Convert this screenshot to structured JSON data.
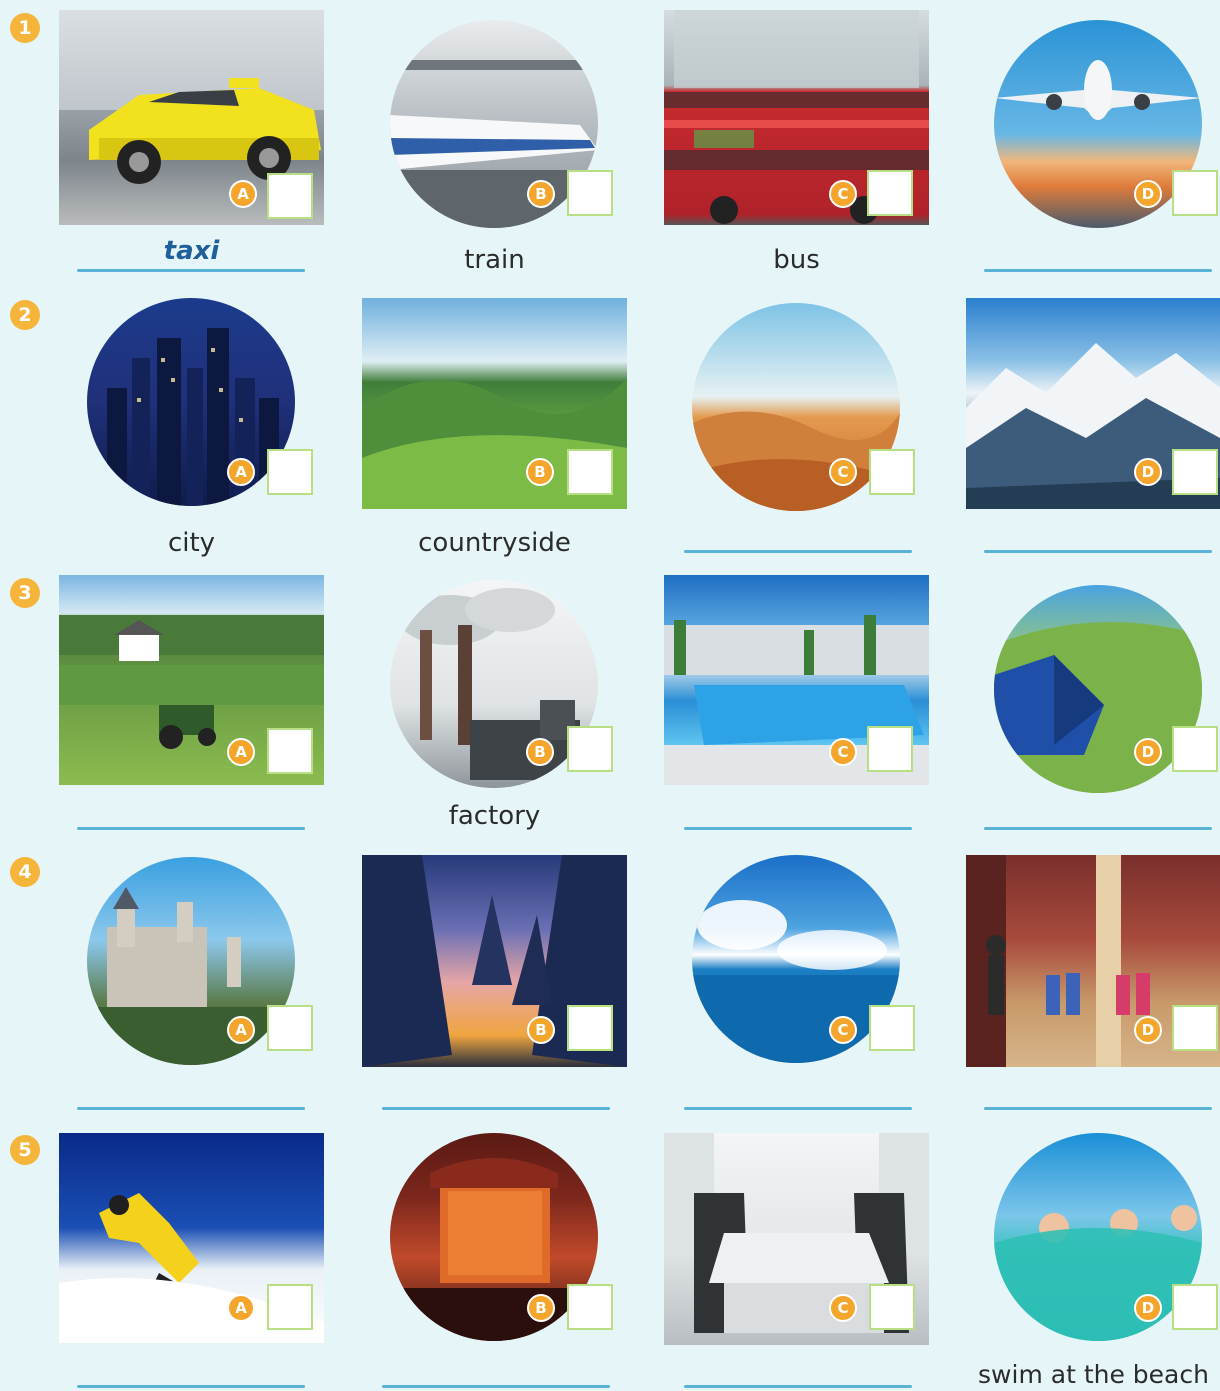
{
  "rows": [
    {
      "number": "1",
      "cells": [
        {
          "letter": "A",
          "caption": "taxi",
          "style": "written"
        },
        {
          "letter": "B",
          "caption": "train"
        },
        {
          "letter": "C",
          "caption": "bus"
        },
        {
          "letter": "D",
          "caption": ""
        }
      ]
    },
    {
      "number": "2",
      "cells": [
        {
          "letter": "A",
          "caption": "city"
        },
        {
          "letter": "B",
          "caption": "countryside"
        },
        {
          "letter": "C",
          "caption": ""
        },
        {
          "letter": "D",
          "caption": ""
        }
      ]
    },
    {
      "number": "3",
      "cells": [
        {
          "letter": "A",
          "caption": ""
        },
        {
          "letter": "B",
          "caption": "factory"
        },
        {
          "letter": "C",
          "caption": ""
        },
        {
          "letter": "D",
          "caption": ""
        }
      ]
    },
    {
      "number": "4",
      "cells": [
        {
          "letter": "A",
          "caption": ""
        },
        {
          "letter": "B",
          "caption": ""
        },
        {
          "letter": "C",
          "caption": ""
        },
        {
          "letter": "D",
          "caption": ""
        }
      ]
    },
    {
      "number": "5",
      "cells": [
        {
          "letter": "A",
          "caption": ""
        },
        {
          "letter": "B",
          "caption": ""
        },
        {
          "letter": "C",
          "caption": ""
        },
        {
          "letter": "D",
          "caption": "swim at the beach"
        }
      ]
    }
  ],
  "colors": {
    "background": "#e6f6f8",
    "badge": "#f4a52b",
    "answer_line": "#58b3d6",
    "box_border": "#b9df85",
    "written_answer": "#1f5f9c"
  }
}
